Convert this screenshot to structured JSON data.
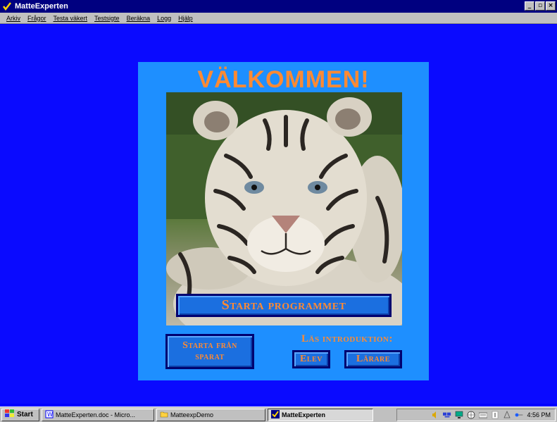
{
  "window": {
    "title": "MatteExperten",
    "minimize": "_",
    "restore": "▫",
    "close": "×"
  },
  "menu": [
    "Arkiv",
    "Frågor",
    "Testa väkert",
    "Testsigte",
    "Beräkna",
    "Logg",
    "Hjälp"
  ],
  "main": {
    "welcome": "VÄLKOMMEN!",
    "start_button": "Starta programmet",
    "start_saved_line1": "Starta från",
    "start_saved_line2": "sparat",
    "intro_label": "Läs introduktion:",
    "elev_button": "Elev",
    "larare_button": "Lärare"
  },
  "taskbar": {
    "start": "Start",
    "items": [
      "MatteExperten.doc - Micro...",
      "MatteexpDemo",
      "MatteExperten"
    ],
    "clock": "4:56 PM"
  },
  "colors": {
    "accent_orange": "#ff8a33",
    "background_blue": "#0a0aff",
    "panel_blue": "#1e8fff"
  }
}
